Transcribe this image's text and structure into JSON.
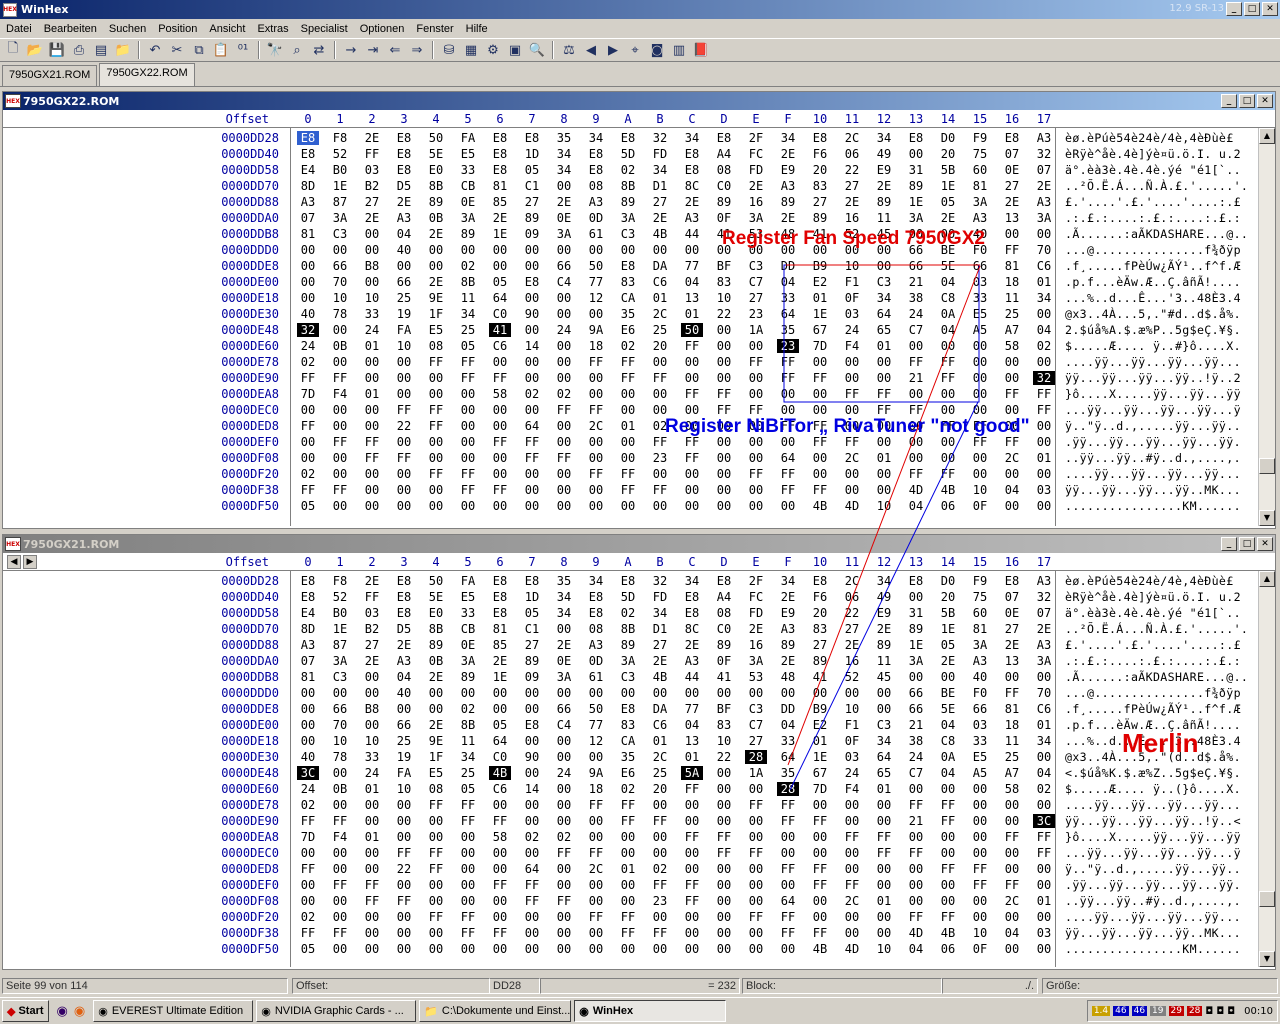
{
  "app": {
    "title": "WinHex",
    "version": "12.9 SR-13"
  },
  "menu": [
    "Datei",
    "Bearbeiten",
    "Suchen",
    "Position",
    "Ansicht",
    "Extras",
    "Specialist",
    "Optionen",
    "Fenster",
    "Hilfe"
  ],
  "toolbar_icons": [
    "new-file-icon",
    "open-file-icon",
    "save-icon",
    "print-icon",
    "properties-icon",
    "open-folder-icon",
    "undo-icon",
    "cut-icon",
    "copy-icon",
    "paste-icon",
    "binary-icon",
    "find-icon",
    "find-hex-icon",
    "replace-hex-icon",
    "goto-offset-icon",
    "goto-marker-icon",
    "back-icon",
    "forward-icon",
    "disk-icon",
    "ram-icon",
    "disk-tools-icon",
    "calculator-icon",
    "search-icon",
    "compare-icon",
    "prev-icon",
    "next-icon",
    "find-next-icon",
    "camera-icon",
    "table-icon",
    "book-icon"
  ],
  "tabs": [
    "7950GX21.ROM",
    "7950GX22.ROM"
  ],
  "header": {
    "offset_label": "Offset",
    "columns": [
      "0",
      "1",
      "2",
      "3",
      "4",
      "5",
      "6",
      "7",
      "8",
      "9",
      "A",
      "B",
      "C",
      "D",
      "E",
      "F",
      "10",
      "11",
      "12",
      "13",
      "14",
      "15",
      "16",
      "17"
    ]
  },
  "panes": [
    {
      "title": "7950GX22.ROM",
      "active": true,
      "rows": [
        {
          "offset": "0000DD28",
          "hex": "E8 F8 2E E8 50 FA E8 E8 35 34 E8 32 34 E8 2F 34 E8 2C 34 E8 D0 F9 E8 A3",
          "ascii": "èø.èPúè54è24è/4è,4èÐùè£"
        },
        {
          "offset": "0000DD40",
          "hex": "E8 52 FF E8 5E E5 E8 1D 34 E8 5D FD E8 A4 FC 2E F6 06 49 00 20 75 07 32",
          "ascii": "èRÿè^åè.4è]ýè¤ü.ö.I. u.2"
        },
        {
          "offset": "0000DD58",
          "hex": "E4 B0 03 E8 E0 33 E8 05 34 E8 02 34 E8 08 FD E9 20 22 E9 31 5B 60 0E 07",
          "ascii": "ä°.èà3è.4è.4è.ýé \"é1[`.."
        },
        {
          "offset": "0000DD70",
          "hex": "8D 1E B2 D5 8B CB 81 C1 00 08 8B D1 8C C0 2E A3 83 27 2E 89 1E 81 27 2E",
          "ascii": "..²Õ.Ë.Á...Ñ.À.£.'.....'."
        },
        {
          "offset": "0000DD88",
          "hex": "A3 87 27 2E 89 0E 85 27 2E A3 89 27 2E 89 16 89 27 2E 89 1E 05 3A 2E A3",
          "ascii": "£.'....'.£.'....'....:.£"
        },
        {
          "offset": "0000DDA0",
          "hex": "07 3A 2E A3 0B 3A 2E 89 0E 0D 3A 2E A3 0F 3A 2E 89 16 11 3A 2E A3 13 3A",
          "ascii": ".:.£.:....:.£.:....:.£.:"
        },
        {
          "offset": "0000DDB8",
          "hex": "81 C3 00 04 2E 89 1E 09 3A 61 C3 4B 44 41 53 48 41 52 45 00 00 40 00 00",
          "ascii": ".Ã......:aÃKDASHARE...@.."
        },
        {
          "offset": "0000DDD0",
          "hex": "00 00 00 40 00 00 00 00 00 00 00 00 00 00 00 00 00 00 00 66 BE F0 FF 70",
          "ascii": "...@...............f¾ðÿp"
        },
        {
          "offset": "0000DDE8",
          "hex": "00 66 B8 00 00 02 00 00 66 50 E8 DA 77 BF C3 DD B9 10 00 66 5E 66 81 C6",
          "ascii": ".f¸.....fPèÚw¿ÃÝ¹..f^f.Æ"
        },
        {
          "offset": "0000DE00",
          "hex": "00 70 00 66 2E 8B 05 E8 C4 77 83 C6 04 83 C7 04 E2 F1 C3 21 04 03 18 01",
          "ascii": ".p.f...èÄw.Æ..Ç.âñÃ!...."
        },
        {
          "offset": "0000DE18",
          "hex": "00 10 10 25 9E 11 64 00 00 12 CA 01 13 10 27 33 01 0F 34 38 C8 33 11 34",
          "ascii": "...%..d...Ê...'3..48È3.4"
        },
        {
          "offset": "0000DE30",
          "hex": "40 78 33 19 1F 34 C0 90 00 00 35 2C 01 22 23 64 1E 03 64 24 0A E5 25 00",
          "ascii": "@x3..4À...5,.\"#d..d$.å%."
        },
        {
          "offset": "0000DE48",
          "hex": "32 00 24 FA E5 25 41 00 24 9A E6 25 50 00 1A 35 67 24 65 C7 04 A5 A7 04",
          "ascii": "2.$úå%A.$.æ%P..5g$eÇ.¥§.",
          "hl": [
            0,
            6,
            12
          ]
        },
        {
          "offset": "0000DE60",
          "hex": "24 0B 01 10 08 05 C6 14 00 18 02 20 FF 00 00 23 7D F4 01 00 00 00 58 02",
          "ascii": "$.....Æ.... ÿ..#}ô....X.",
          "hl": [
            15
          ]
        },
        {
          "offset": "0000DE78",
          "hex": "02 00 00 00 FF FF 00 00 00 FF FF 00 00 00 FF FF 00 00 00 FF FF 00 00 00",
          "ascii": "....ÿÿ...ÿÿ...ÿÿ...ÿÿ..."
        },
        {
          "offset": "0000DE90",
          "hex": "FF FF 00 00 00 FF FF 00 00 00 FF FF 00 00 00 FF FF 00 00 21 FF 00 00 32",
          "ascii": "ÿÿ...ÿÿ...ÿÿ...ÿÿ..!ÿ..2",
          "hl": [
            23
          ]
        },
        {
          "offset": "0000DEA8",
          "hex": "7D F4 01 00 00 00 58 02 02 00 00 00 FF FF 00 00 00 FF FF 00 00 00 FF FF",
          "ascii": "}ô....X.....ÿÿ...ÿÿ...ÿÿ"
        },
        {
          "offset": "0000DEC0",
          "hex": "00 00 00 FF FF 00 00 00 FF FF 00 00 00 FF FF 00 00 00 FF FF 00 00 00 FF",
          "ascii": "...ÿÿ...ÿÿ...ÿÿ...ÿÿ...ÿ"
        },
        {
          "offset": "0000DED8",
          "hex": "FF 00 00 22 FF 00 00 64 00 2C 01 02 00 00 00 FF FF 00 00 00 FF FF 00 00",
          "ascii": "ÿ..\"ÿ..d.,.....ÿÿ...ÿÿ.."
        },
        {
          "offset": "0000DEF0",
          "hex": "00 FF FF 00 00 00 FF FF 00 00 00 FF FF 00 00 00 FF FF 00 00 00 FF FF 00",
          "ascii": ".ÿÿ...ÿÿ...ÿÿ...ÿÿ...ÿÿ."
        },
        {
          "offset": "0000DF08",
          "hex": "00 00 FF FF 00 00 00 FF FF 00 00 23 FF 00 00 64 00 2C 01 00 00 00 2C 01",
          "ascii": "..ÿÿ...ÿÿ..#ÿ..d.,....,."
        },
        {
          "offset": "0000DF20",
          "hex": "02 00 00 00 FF FF 00 00 00 FF FF 00 00 00 FF FF 00 00 00 FF FF 00 00 00",
          "ascii": "....ÿÿ...ÿÿ...ÿÿ...ÿÿ..."
        },
        {
          "offset": "0000DF38",
          "hex": "FF FF 00 00 00 FF FF 00 00 00 FF FF 00 00 00 FF FF 00 00 4D 4B 10 04 03",
          "ascii": "ÿÿ...ÿÿ...ÿÿ...ÿÿ..MK..."
        },
        {
          "offset": "0000DF50",
          "hex": "05 00 00 00 00 00 00 00 00 00 00 00 00 00 00 00 4B 4D 10 04 06 0F 00 00",
          "ascii": "................KM......"
        }
      ]
    },
    {
      "title": "7950GX21.ROM",
      "active": false,
      "rows": [
        {
          "offset": "0000DD28",
          "hex": "E8 F8 2E E8 50 FA E8 E8 35 34 E8 32 34 E8 2F 34 E8 2C 34 E8 D0 F9 E8 A3",
          "ascii": "èø.èPúè54è24è/4è,4èÐùè£"
        },
        {
          "offset": "0000DD40",
          "hex": "E8 52 FF E8 5E E5 E8 1D 34 E8 5D FD E8 A4 FC 2E F6 06 49 00 20 75 07 32",
          "ascii": "èRÿè^åè.4è]ýè¤ü.ö.I. u.2"
        },
        {
          "offset": "0000DD58",
          "hex": "E4 B0 03 E8 E0 33 E8 05 34 E8 02 34 E8 08 FD E9 20 22 E9 31 5B 60 0E 07",
          "ascii": "ä°.èà3è.4è.4è.ýé \"é1[`.."
        },
        {
          "offset": "0000DD70",
          "hex": "8D 1E B2 D5 8B CB 81 C1 00 08 8B D1 8C C0 2E A3 83 27 2E 89 1E 81 27 2E",
          "ascii": "..²Õ.Ë.Á...Ñ.À.£.'.....'."
        },
        {
          "offset": "0000DD88",
          "hex": "A3 87 27 2E 89 0E 85 27 2E A3 89 27 2E 89 16 89 27 2E 89 1E 05 3A 2E A3",
          "ascii": "£.'....'.£.'....'....:.£"
        },
        {
          "offset": "0000DDA0",
          "hex": "07 3A 2E A3 0B 3A 2E 89 0E 0D 3A 2E A3 0F 3A 2E 89 16 11 3A 2E A3 13 3A",
          "ascii": ".:.£.:....:.£.:....:.£.:"
        },
        {
          "offset": "0000DDB8",
          "hex": "81 C3 00 04 2E 89 1E 09 3A 61 C3 4B 44 41 53 48 41 52 45 00 00 40 00 00",
          "ascii": ".Ã......:aÃKDASHARE...@.."
        },
        {
          "offset": "0000DDD0",
          "hex": "00 00 00 40 00 00 00 00 00 00 00 00 00 00 00 00 00 00 00 66 BE F0 FF 70",
          "ascii": "...@...............f¾ðÿp"
        },
        {
          "offset": "0000DDE8",
          "hex": "00 66 B8 00 00 02 00 00 66 50 E8 DA 77 BF C3 DD B9 10 00 66 5E 66 81 C6",
          "ascii": ".f¸.....fPèÚw¿ÃÝ¹..f^f.Æ"
        },
        {
          "offset": "0000DE00",
          "hex": "00 70 00 66 2E 8B 05 E8 C4 77 83 C6 04 83 C7 04 E2 F1 C3 21 04 03 18 01",
          "ascii": ".p.f...èÄw.Æ..Ç.âñÃ!...."
        },
        {
          "offset": "0000DE18",
          "hex": "00 10 10 25 9E 11 64 00 00 12 CA 01 13 10 27 33 01 0F 34 38 C8 33 11 34",
          "ascii": "...%..d...Ê...'3..48È3.4"
        },
        {
          "offset": "0000DE30",
          "hex": "40 78 33 19 1F 34 C0 90 00 00 35 2C 01 22 28 64 1E 03 64 24 0A E5 25 00",
          "ascii": "@x3..4À...5,.\"(d..d$.å%.",
          "hl": [
            14
          ]
        },
        {
          "offset": "0000DE48",
          "hex": "3C 00 24 FA E5 25 4B 00 24 9A E6 25 5A 00 1A 35 67 24 65 C7 04 A5 A7 04",
          "ascii": "<.$úå%K.$.æ%Z..5g$eÇ.¥§.",
          "hl": [
            0,
            6,
            12
          ]
        },
        {
          "offset": "0000DE60",
          "hex": "24 0B 01 10 08 05 C6 14 00 18 02 20 FF 00 00 28 7D F4 01 00 00 00 58 02",
          "ascii": "$.....Æ.... ÿ..(}ô....X.",
          "hl": [
            15
          ]
        },
        {
          "offset": "0000DE78",
          "hex": "02 00 00 00 FF FF 00 00 00 FF FF 00 00 00 FF FF 00 00 00 FF FF 00 00 00",
          "ascii": "....ÿÿ...ÿÿ...ÿÿ...ÿÿ..."
        },
        {
          "offset": "0000DE90",
          "hex": "FF FF 00 00 00 FF FF 00 00 00 FF FF 00 00 00 FF FF 00 00 21 FF 00 00 3C",
          "ascii": "ÿÿ...ÿÿ...ÿÿ...ÿÿ..!ÿ..<",
          "hl": [
            23
          ]
        },
        {
          "offset": "0000DEA8",
          "hex": "7D F4 01 00 00 00 58 02 02 00 00 00 FF FF 00 00 00 FF FF 00 00 00 FF FF",
          "ascii": "}ô....X.....ÿÿ...ÿÿ...ÿÿ"
        },
        {
          "offset": "0000DEC0",
          "hex": "00 00 00 FF FF 00 00 00 FF FF 00 00 00 FF FF 00 00 00 FF FF 00 00 00 FF",
          "ascii": "...ÿÿ...ÿÿ...ÿÿ...ÿÿ...ÿ"
        },
        {
          "offset": "0000DED8",
          "hex": "FF 00 00 22 FF 00 00 64 00 2C 01 02 00 00 00 FF FF 00 00 00 FF FF 00 00",
          "ascii": "ÿ..\"ÿ..d.,.....ÿÿ...ÿÿ.."
        },
        {
          "offset": "0000DEF0",
          "hex": "00 FF FF 00 00 00 FF FF 00 00 00 FF FF 00 00 00 FF FF 00 00 00 FF FF 00",
          "ascii": ".ÿÿ...ÿÿ...ÿÿ...ÿÿ...ÿÿ."
        },
        {
          "offset": "0000DF08",
          "hex": "00 00 FF FF 00 00 00 FF FF 00 00 23 FF 00 00 64 00 2C 01 00 00 00 2C 01",
          "ascii": "..ÿÿ...ÿÿ..#ÿ..d.,....,."
        },
        {
          "offset": "0000DF20",
          "hex": "02 00 00 00 FF FF 00 00 00 FF FF 00 00 00 FF FF 00 00 00 FF FF 00 00 00",
          "ascii": "....ÿÿ...ÿÿ...ÿÿ...ÿÿ..."
        },
        {
          "offset": "0000DF38",
          "hex": "FF FF 00 00 00 FF FF 00 00 00 FF FF 00 00 00 FF FF 00 00 4D 4B 10 04 03",
          "ascii": "ÿÿ...ÿÿ...ÿÿ...ÿÿ..MK..."
        },
        {
          "offset": "0000DF50",
          "hex": "05 00 00 00 00 00 00 00 00 00 00 00 00 00 00 00 4B 4D 10 04 06 0F 00 00",
          "ascii": "................KM......"
        }
      ]
    }
  ],
  "annotations": {
    "fan_speed": "Register Fan Speed 7950GX2",
    "nibitor": "Register NiBiTor „ RivaTuner \"not good\"",
    "merlin": "Merlin"
  },
  "status": {
    "page": "Seite 99 von 114",
    "offset_label": "Offset:",
    "offset_value": "DD28",
    "value": "= 232",
    "block_label": "Block:",
    "block_value": "./.",
    "size_label": "Größe:"
  },
  "taskbar": {
    "start": "Start",
    "tasks": [
      "EVEREST Ultimate Edition",
      "NVIDIA Graphic Cards - ...",
      "C:\\Dokumente und Einst...",
      "WinHex"
    ],
    "active_task": 3,
    "clock": "00:10",
    "tray_values": [
      "1.4",
      "46",
      "46",
      "19",
      "29",
      "28"
    ]
  },
  "colors": {
    "annot_red": "#e00000",
    "annot_blue": "#0000e0",
    "offset_blue": "#0000a0",
    "title_blue": "#0a246a"
  }
}
